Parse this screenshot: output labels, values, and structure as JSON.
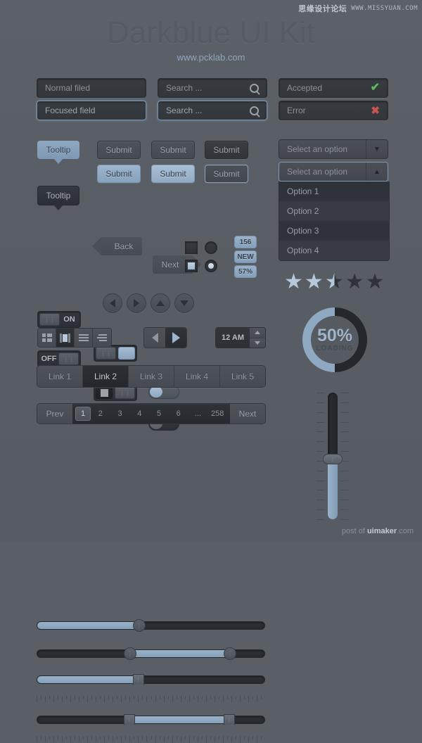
{
  "watermark": {
    "cn": "思缘设计论坛",
    "en": "WWW.MISSYUAN.COM"
  },
  "header": {
    "title": "Darkblue UI Kit",
    "subtitle": "www.pcklab.com"
  },
  "fields": {
    "normal": {
      "value": "Normal filed"
    },
    "focused": {
      "value": "Focused field"
    },
    "search_normal": {
      "value": "Search ...",
      "icon": "search-icon"
    },
    "search_focused": {
      "value": "Search ...",
      "icon": "search-icon"
    },
    "accepted": {
      "value": "Accepted",
      "icon": "check-icon",
      "color": "#5cb85c"
    },
    "error": {
      "value": "Error",
      "icon": "x-icon",
      "color": "#c9534f"
    }
  },
  "tooltips": {
    "light": "Tooltip",
    "dark": "Tooltip"
  },
  "buttons": {
    "submit": "Submit",
    "row1": [
      "Submit",
      "Submit",
      "Submit"
    ],
    "row2": [
      "Submit",
      "Submit",
      "Submit"
    ],
    "back": "Back",
    "next": "Next"
  },
  "select": {
    "placeholder_closed": "Select an option",
    "placeholder_open": "Select an option",
    "options": [
      "Option 1",
      "Option 2",
      "Option 3",
      "Option 4"
    ]
  },
  "switches": {
    "on_label": "ON",
    "off_label": "OFF"
  },
  "badges": [
    "156",
    "NEW",
    "57%"
  ],
  "rating": {
    "filled": 2,
    "half": 1,
    "empty": 2,
    "total": 5
  },
  "loading": {
    "percent": "50%",
    "label": "LOADING",
    "value": 50
  },
  "view_toggle": {
    "items": [
      "grid-view-icon",
      "card-view-icon",
      "list-view-icon",
      "detail-view-icon"
    ],
    "active_index": 1
  },
  "media": {
    "prev": "prev-icon",
    "play": "play-icon"
  },
  "stepper": {
    "value": "12 AM",
    "up": "up-arrow-icon",
    "down": "down-arrow-icon"
  },
  "tabs": {
    "items": [
      "Link 1",
      "Link 2",
      "Link 3",
      "Link 4",
      "Link 5"
    ],
    "active_index": 1
  },
  "pagination": {
    "prev": "Prev",
    "next": "Next",
    "pages": [
      "1",
      "2",
      "3",
      "4",
      "5",
      "6",
      "...",
      "258"
    ],
    "current": "1"
  },
  "sliders": [
    {
      "name": "single-handle-slider",
      "fill_start": 0,
      "fill_end": 45,
      "handles": [
        45
      ]
    },
    {
      "name": "range-slider",
      "fill_start": 41,
      "fill_end": 85,
      "handles": [
        41,
        85
      ]
    },
    {
      "name": "single-handle-tick-slider",
      "fill_start": 0,
      "fill_end": 45,
      "handles": [
        45
      ]
    },
    {
      "name": "range-tick-slider",
      "fill_start": 41,
      "fill_end": 85,
      "handles": [
        41,
        85
      ]
    }
  ],
  "vertical_slider": {
    "fill_percent": 48,
    "handle_percent": 52
  },
  "footer": {
    "pre": "post of ",
    "brand": "uimaker",
    "post": ".com"
  }
}
